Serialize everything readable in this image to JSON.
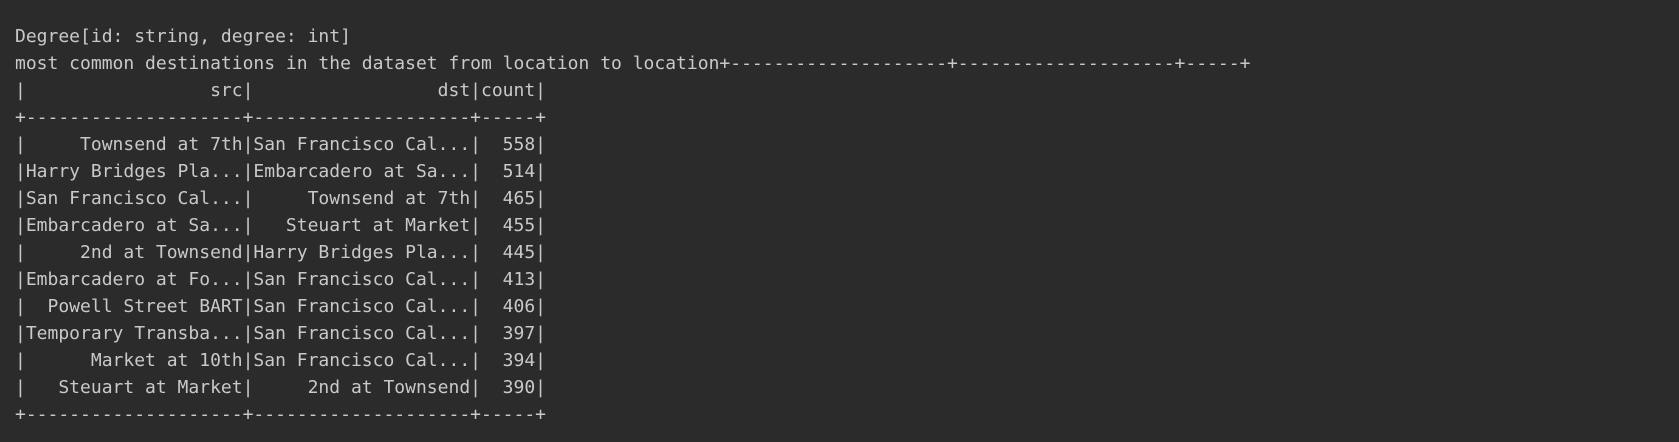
{
  "console": {
    "lines": [
      "Degree[id: string, degree: int]",
      "most common destinations in the dataset from location to location+--------------------+--------------------+-----+",
      "|                 src|                 dst|count|",
      "+--------------------+--------------------+-----+",
      "|     Townsend at 7th|San Francisco Cal...|  558|",
      "|Harry Bridges Pla...|Embarcadero at Sa...|  514|",
      "|San Francisco Cal...|     Townsend at 7th|  465|",
      "|Embarcadero at Sa...|   Steuart at Market|  455|",
      "|     2nd at Townsend|Harry Bridges Pla...|  445|",
      "|Embarcadero at Fo...|San Francisco Cal...|  413|",
      "|  Powell Street BART|San Francisco Cal...|  406|",
      "|Temporary Transba...|San Francisco Cal...|  397|",
      "|      Market at 10th|San Francisco Cal...|  394|",
      "|   Steuart at Market|     2nd at Townsend|  390|",
      "+--------------------+--------------------+-----+"
    ]
  },
  "colors": {
    "background": "#2b2b2b",
    "text": "#c9c9c9"
  }
}
